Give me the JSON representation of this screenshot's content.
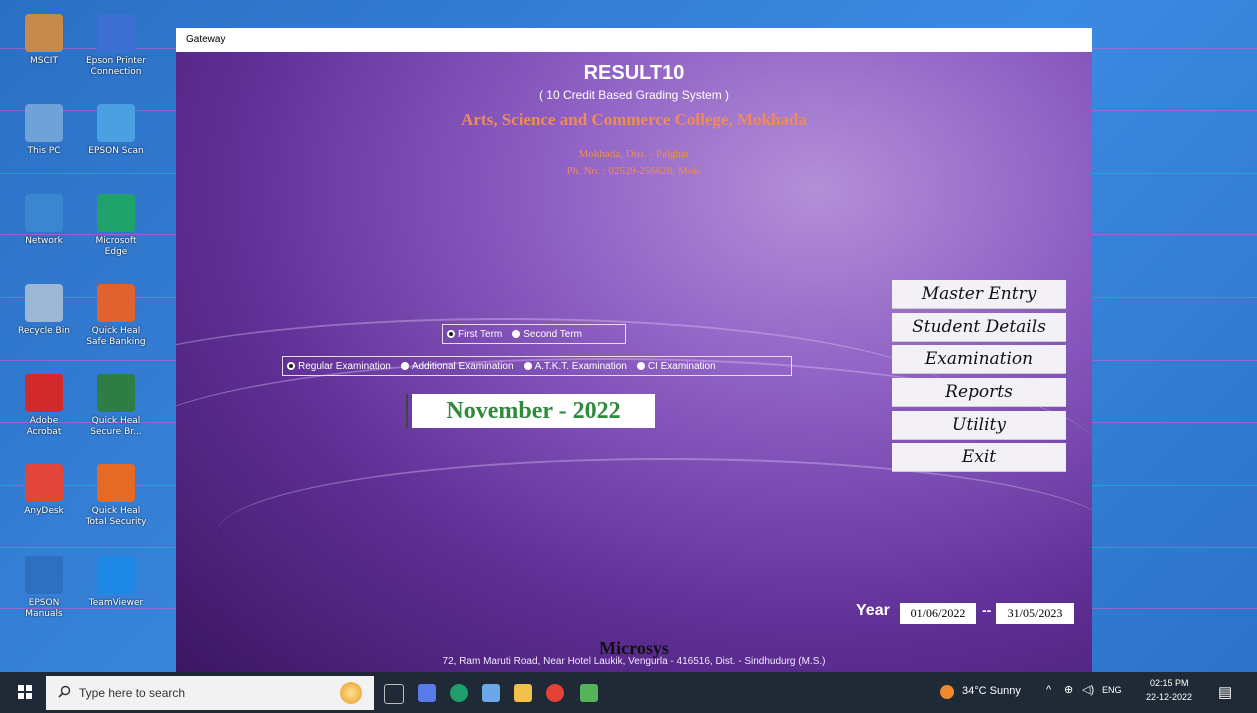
{
  "desktop": {
    "icons": [
      {
        "label": "MSCIT",
        "color": "#c58a4a"
      },
      {
        "label": "Epson Printer\nConnection",
        "color": "#3b6fd1"
      },
      {
        "label": "This PC",
        "color": "#6fa3d8"
      },
      {
        "label": "EPSON Scan",
        "color": "#4aa0e0"
      },
      {
        "label": "Network",
        "color": "#3a86cf"
      },
      {
        "label": "Microsoft\nEdge",
        "color": "#1fa36a"
      },
      {
        "label": "Recycle Bin",
        "color": "#9bb7d4"
      },
      {
        "label": "Quick Heal\nSafe Banking",
        "color": "#e0622e"
      },
      {
        "label": "Adobe\nAcrobat",
        "color": "#d2292d"
      },
      {
        "label": "Quick Heal\nSecure Br...",
        "color": "#2e7d44"
      },
      {
        "label": "AnyDesk",
        "color": "#e2463b"
      },
      {
        "label": "Quick Heal\nTotal Security",
        "color": "#e56a24"
      },
      {
        "label": "EPSON\nManuals",
        "color": "#2d6fc0"
      },
      {
        "label": "TeamViewer",
        "color": "#1e88e5"
      }
    ]
  },
  "window": {
    "title": "Gateway",
    "app_title": "RESULT10",
    "app_subtitle": "( 10 Credit Based Grading System )",
    "college": "Arts, Science and Commerce College, Mokhada",
    "address": "Mokhada, Dist. - Palghar",
    "phone": "Ph. No. : 02529-256628, Mob."
  },
  "term": {
    "options": [
      "First Term",
      "Second Term"
    ],
    "selected": "First Term"
  },
  "exam_type": {
    "options": [
      "Regular Examination",
      "Additional Examination",
      "A.T.K.T. Examination",
      "CI Examination"
    ],
    "selected": "Regular Examination"
  },
  "session": "November - 2022",
  "menu": [
    "Master Entry",
    "Student Details",
    "Examination",
    "Reports",
    "Utility",
    "Exit"
  ],
  "year": {
    "label": "Year",
    "from": "01/06/2022",
    "separator": "--",
    "to": "31/05/2023"
  },
  "footer": {
    "company": "Microsys",
    "address": "72, Ram Maruti Road, Near Hotel Laukik, Vengurla - 416516, Dist. - Sindhudurg (M.S.)"
  },
  "taskbar": {
    "search_placeholder": "Type here to search",
    "weather": "34°C  Sunny",
    "language": "ENG",
    "time": "02:15 PM",
    "date": "22-12-2022"
  }
}
